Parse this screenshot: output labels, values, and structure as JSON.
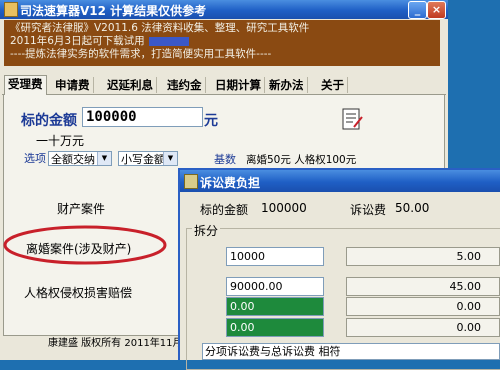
{
  "main": {
    "title": "司法速算器V12    计算结果仅供参考",
    "window_controls": [
      "_",
      "×"
    ]
  },
  "banner": {
    "line1": "《研究者法律服》V2011.6    法律资料收集、整理、研究工具软件",
    "line2": "2011年6月3日起可下载试用",
    "line3": "----提炼法律实务的软件需求，打造简便实用工具软件----"
  },
  "tabs": [
    "受理费",
    "申请费",
    "迟延利息",
    "违约金",
    "日期计算",
    "新办法",
    "关于"
  ],
  "form": {
    "amount_label": "标的金额",
    "amount_value": "100000",
    "amount_unit": "元",
    "amount_chinese": "一十万元",
    "options_label": "选项",
    "select1": "全额交纳",
    "select2": "小写金额",
    "base_label": "基数",
    "base_values": "离婚50元  人格权100元"
  },
  "cases": {
    "property": "财产案件",
    "divorce": "离婚案件(涉及财产)",
    "personal": "人格权侵权损害赔偿"
  },
  "footer": "康建盛 版权所有    2011年11月",
  "dialog": {
    "title": "诉讼费负担",
    "amount_label": "标的金额",
    "amount_value": "100000",
    "fee_label": "诉讼费",
    "fee_value": "50.00",
    "split_label": "拆分",
    "rows": [
      {
        "input": "10000",
        "output": "5.00"
      },
      {
        "input": "90000.00",
        "output": "45.00"
      },
      {
        "input": "0.00",
        "output": "0.00"
      },
      {
        "input": "0.00",
        "output": "0.00"
      }
    ],
    "summary": "分项诉讼费与总诉讼费 相符"
  },
  "colors": {
    "titlebar": "#1f5fc5",
    "banner": "#8a4a12",
    "accent_blue": "#1c3a96",
    "highlight_red": "#c8202a",
    "green_cell": "#1e8a3c"
  }
}
